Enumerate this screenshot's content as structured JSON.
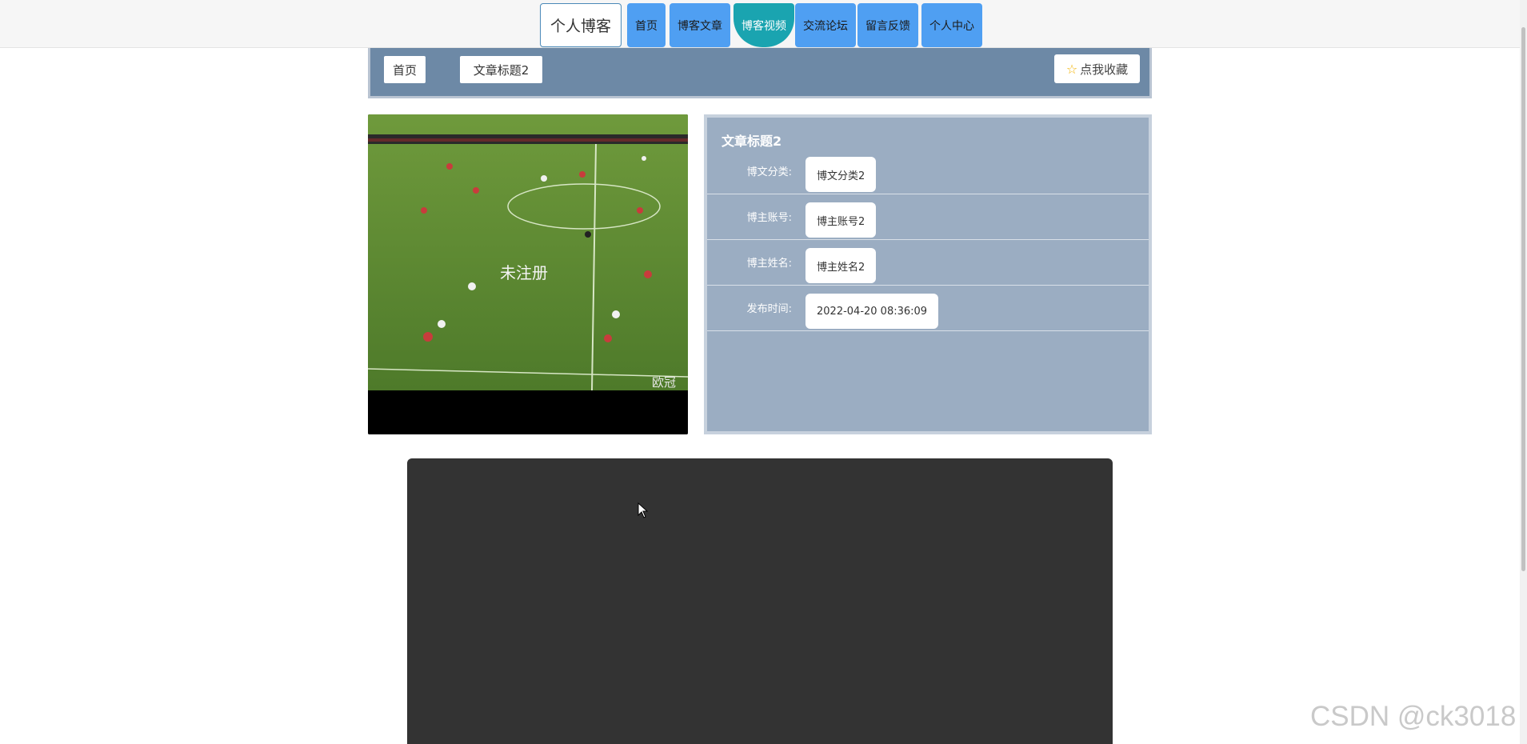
{
  "nav": {
    "brand": "个人博客",
    "items": [
      {
        "label": "首页"
      },
      {
        "label": "博客文章"
      },
      {
        "label": "博客视频",
        "active": true
      },
      {
        "label": "交流论坛"
      },
      {
        "label": "留言反馈"
      },
      {
        "label": "个人中心"
      }
    ],
    "accent_color": "#4f9ff2",
    "active_color": "#1aa4b0"
  },
  "breadcrumb": {
    "home": "首页",
    "current": "文章标题2",
    "favorite_label": "点我收藏",
    "favorite_icon": "star-icon"
  },
  "article": {
    "title": "文章标题2",
    "fields": [
      {
        "label": "博文分类:",
        "value": "博文分类2"
      },
      {
        "label": "博主账号:",
        "value": "博主账号2"
      },
      {
        "label": "博主姓名:",
        "value": "博主姓名2"
      },
      {
        "label": "发布时间:",
        "value": "2022-04-20 08:36:09"
      }
    ]
  },
  "video": {
    "thumbnail_caption": "未注册",
    "corner_text": "欧冠"
  },
  "watermark": "CSDN @ck3018"
}
